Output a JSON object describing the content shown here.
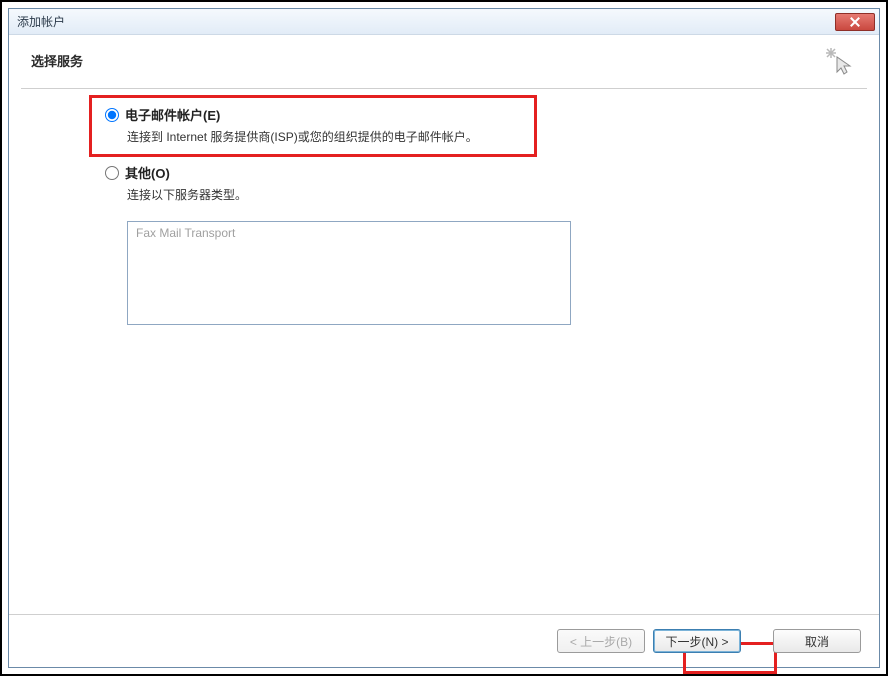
{
  "window": {
    "title": "添加帐户"
  },
  "header": {
    "title": "选择服务"
  },
  "options": {
    "email": {
      "label": "电子邮件帐户(E)",
      "desc": "连接到 Internet 服务提供商(ISP)或您的组织提供的电子邮件帐户。"
    },
    "other": {
      "label": "其他(O)",
      "desc": "连接以下服务器类型。"
    }
  },
  "server_list": {
    "item0": "Fax Mail Transport"
  },
  "buttons": {
    "back": "< 上一步(B)",
    "next": "下一步(N) >",
    "cancel": "取消"
  }
}
